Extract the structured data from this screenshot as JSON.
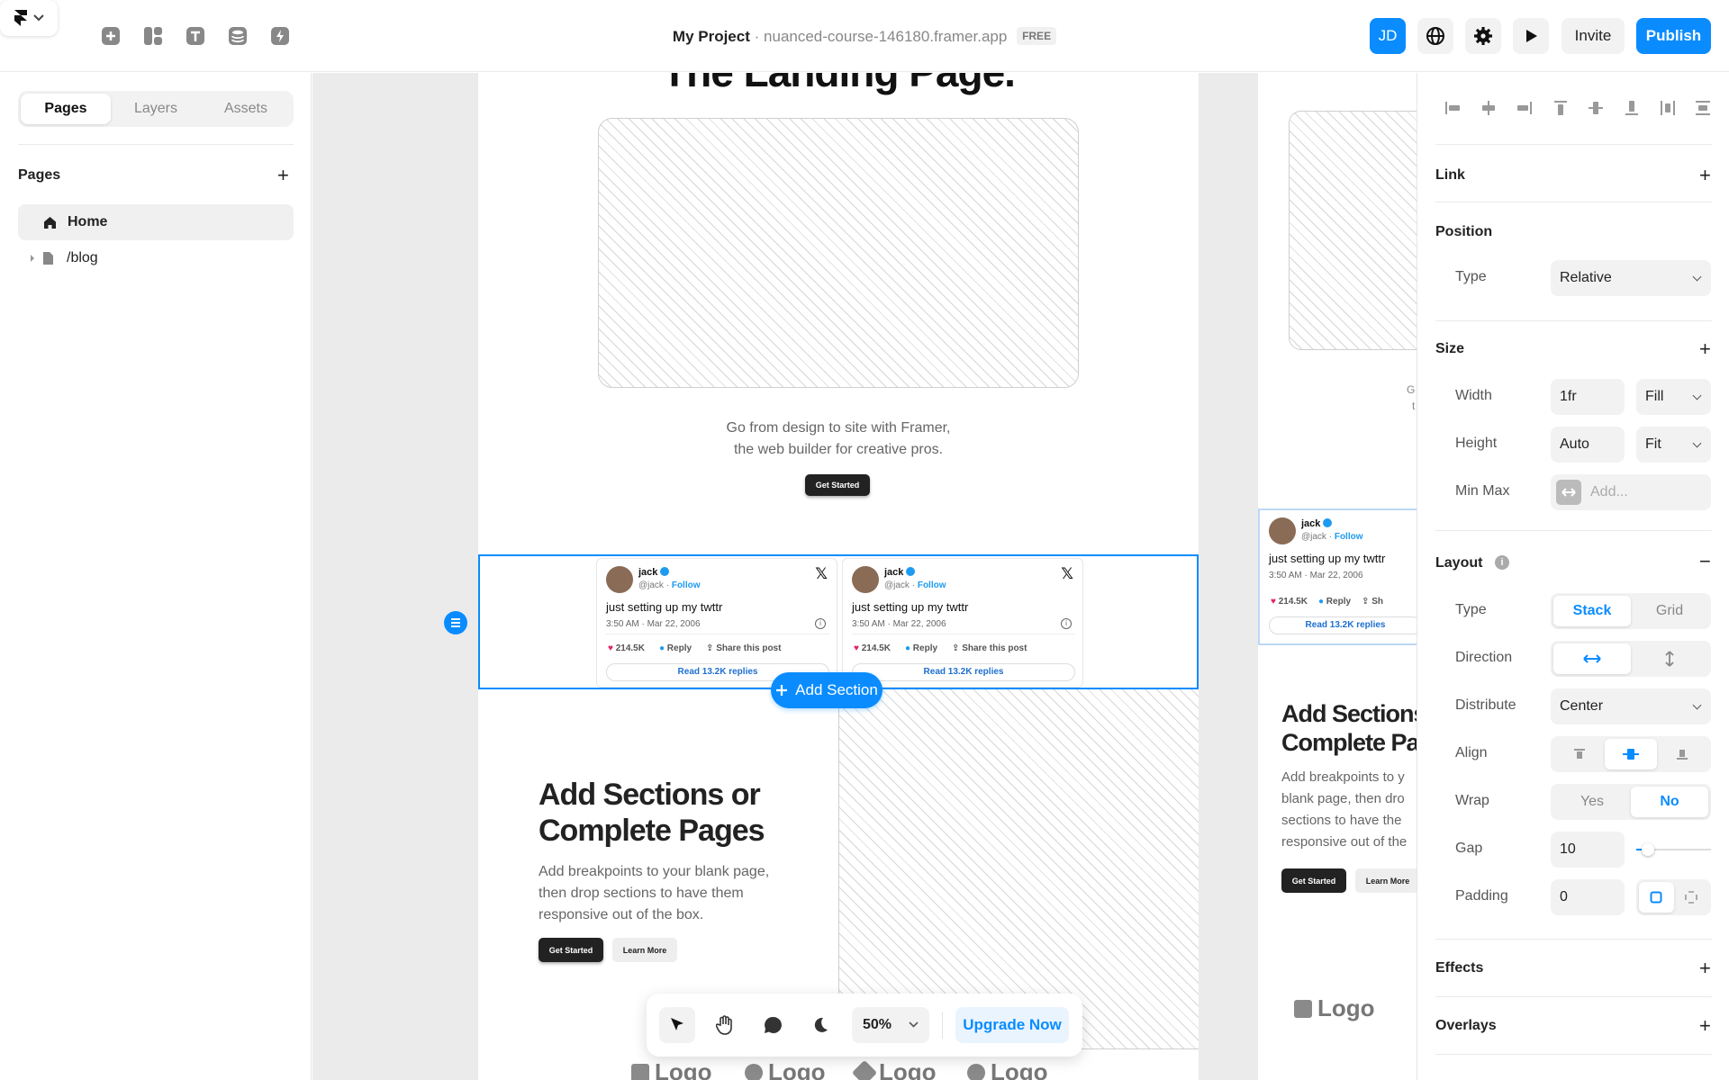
{
  "topbar": {
    "project_title": "My Project",
    "separator": "·",
    "project_url": "nuanced-course-146180.framer.app",
    "plan_badge": "FREE",
    "avatar_initials": "JD",
    "invite_label": "Invite",
    "publish_label": "Publish",
    "icons": [
      "framer-logo-icon",
      "chevron-down-icon",
      "insert-icon",
      "layout-icon",
      "text-icon",
      "cms-icon",
      "plugins-icon",
      "globe-icon",
      "gear-icon",
      "play-icon"
    ]
  },
  "left_panel": {
    "tabs": [
      {
        "label": "Pages"
      },
      {
        "label": "Layers"
      },
      {
        "label": "Assets"
      }
    ],
    "active_tab": "Pages",
    "pages_heading": "Pages",
    "add_symbol": "+",
    "pages": [
      {
        "label": "Home",
        "icon": "home-icon"
      },
      {
        "label": "/blog",
        "icon": "file-icon"
      }
    ]
  },
  "canvas": {
    "hero_title": "The Landing Page.",
    "hero_subtitle_1": "Go from design to site with Framer,",
    "hero_subtitle_2": "the web builder for creative pros.",
    "hero_button": "Get Started",
    "tweet": {
      "name": "jack",
      "handle": "@jack",
      "dot": "·",
      "follow": "Follow",
      "x": "𝕏",
      "text": "just setting up my twttr",
      "time": "3:50 AM · Mar 22, 2006",
      "likes": "214.5K",
      "reply": "Reply",
      "share": "Share this post",
      "read": "Read 13.2K replies"
    },
    "add_section_label": "Add Section",
    "feature_title": "Add Sections or Complete Pages",
    "feature_body": "Add breakpoints to your blank page, then drop sections to have them responsive out of the box.",
    "feature_btn_primary": "Get Started",
    "feature_btn_secondary": "Learn More",
    "logo_label": "Logo",
    "right_frame": {
      "fragment_1": "G",
      "fragment_2": "t",
      "title_line_1": "Add Sections",
      "title_line_2": "Complete Pa",
      "body_lines": [
        "Add breakpoints to y",
        "blank page, then dro",
        "sections to have the",
        "responsive out of the"
      ],
      "share_fragment": "Sh"
    }
  },
  "bottom_toolbar": {
    "tools": [
      "cursor-icon",
      "hand-icon",
      "comment-icon",
      "moon-icon"
    ],
    "zoom": "50%",
    "upgrade_label": "Upgrade Now"
  },
  "right_panel": {
    "link_label": "Link",
    "position_label": "Position",
    "position_type_label": "Type",
    "position_type_value": "Relative",
    "size_label": "Size",
    "width_label": "Width",
    "width_value": "1fr",
    "width_mode": "Fill",
    "height_label": "Height",
    "height_value": "Auto",
    "height_mode": "Fit",
    "minmax_label": "Min Max",
    "minmax_placeholder": "Add...",
    "layout_label": "Layout",
    "layout_collapse": "−",
    "layout_type_label": "Type",
    "layout_type_options": [
      "Stack",
      "Grid"
    ],
    "direction_label": "Direction",
    "distribute_label": "Distribute",
    "distribute_value": "Center",
    "align_label": "Align",
    "wrap_label": "Wrap",
    "wrap_options": [
      "Yes",
      "No"
    ],
    "gap_label": "Gap",
    "gap_value": "10",
    "padding_label": "Padding",
    "padding_value": "0",
    "effects_label": "Effects",
    "overlays_label": "Overlays",
    "accent_color": "#0a8cff"
  }
}
